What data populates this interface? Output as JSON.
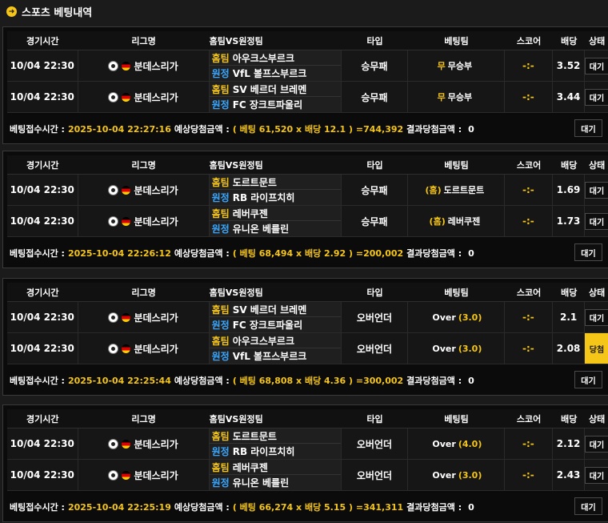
{
  "page": {
    "title": "스포츠 베팅내역"
  },
  "headers": {
    "time": "경기시간",
    "league": "리그명",
    "teams": "홈팀VS원정팀",
    "type": "타입",
    "pick": "베팅팀",
    "score": "스코어",
    "odds": "배당",
    "status": "상태"
  },
  "labels": {
    "home_tag": "홈팀",
    "away_tag": "원정",
    "bet_time": "베팅접수시간 :",
    "expected": "예상당첨금액 :",
    "result": "결과당첨금액 :"
  },
  "slips": [
    {
      "games": [
        {
          "time": "10/04 22:30",
          "league": "분데스리가",
          "home": "아우크스부르크",
          "away": "VfL 볼프스부르크",
          "type": "승무패",
          "pick_prefix": "무",
          "pick": "무승부",
          "pick_suffix": "",
          "score": "-:-",
          "odds": "3.52",
          "status": "대기",
          "win": false
        },
        {
          "time": "10/04 22:30",
          "league": "분데스리가",
          "home": "SV 베르더 브레멘",
          "away": "FC 장크트파울리",
          "type": "승무패",
          "pick_prefix": "무",
          "pick": "무승부",
          "pick_suffix": "",
          "score": "-:-",
          "odds": "3.44",
          "status": "대기",
          "win": false
        }
      ],
      "bet_time": "2025-10-04 22:27:16",
      "calc": "( 베팅 61,520 x 배당 12.1 ) =744,392",
      "result": "0",
      "status": "대기"
    },
    {
      "games": [
        {
          "time": "10/04 22:30",
          "league": "분데스리가",
          "home": "도르트문트",
          "away": "RB 라이프치히",
          "type": "승무패",
          "pick_prefix": "(홈)",
          "pick": "도르트문트",
          "pick_suffix": "",
          "score": "-:-",
          "odds": "1.69",
          "status": "대기",
          "win": false
        },
        {
          "time": "10/04 22:30",
          "league": "분데스리가",
          "home": "레버쿠젠",
          "away": "유니온 베를린",
          "type": "승무패",
          "pick_prefix": "(홈)",
          "pick": "레버쿠젠",
          "pick_suffix": "",
          "score": "-:-",
          "odds": "1.73",
          "status": "대기",
          "win": false
        }
      ],
      "bet_time": "2025-10-04 22:26:12",
      "calc": "( 베팅 68,494 x 배당 2.92 ) =200,002",
      "result": "0",
      "status": "대기"
    },
    {
      "games": [
        {
          "time": "10/04 22:30",
          "league": "분데스리가",
          "home": "SV 베르더 브레멘",
          "away": "FC 장크트파울리",
          "type": "오버언더",
          "pick_prefix": "",
          "pick": "Over",
          "pick_suffix": "(3.0)",
          "score": "-:-",
          "odds": "2.1",
          "status": "대기",
          "win": false
        },
        {
          "time": "10/04 22:30",
          "league": "분데스리가",
          "home": "아우크스부르크",
          "away": "VfL 볼프스부르크",
          "type": "오버언더",
          "pick_prefix": "",
          "pick": "Over",
          "pick_suffix": "(3.0)",
          "score": "-:-",
          "odds": "2.08",
          "status": "당첨",
          "win": true
        }
      ],
      "bet_time": "2025-10-04 22:25:44",
      "calc": "( 베팅 68,808 x 배당 4.36 ) =300,002",
      "result": "0",
      "status": "대기"
    },
    {
      "games": [
        {
          "time": "10/04 22:30",
          "league": "분데스리가",
          "home": "도르트문트",
          "away": "RB 라이프치히",
          "type": "오버언더",
          "pick_prefix": "",
          "pick": "Over",
          "pick_suffix": "(4.0)",
          "score": "-:-",
          "odds": "2.12",
          "status": "대기",
          "win": false
        },
        {
          "time": "10/04 22:30",
          "league": "분데스리가",
          "home": "레버쿠젠",
          "away": "유니온 베를린",
          "type": "오버언더",
          "pick_prefix": "",
          "pick": "Over",
          "pick_suffix": "(3.0)",
          "score": "-:-",
          "odds": "2.43",
          "status": "대기",
          "win": false
        }
      ],
      "bet_time": "2025-10-04 22:25:19",
      "calc": "( 베팅 66,274 x 배당 5.15 ) =341,311",
      "result": "0",
      "status": "대기"
    }
  ]
}
